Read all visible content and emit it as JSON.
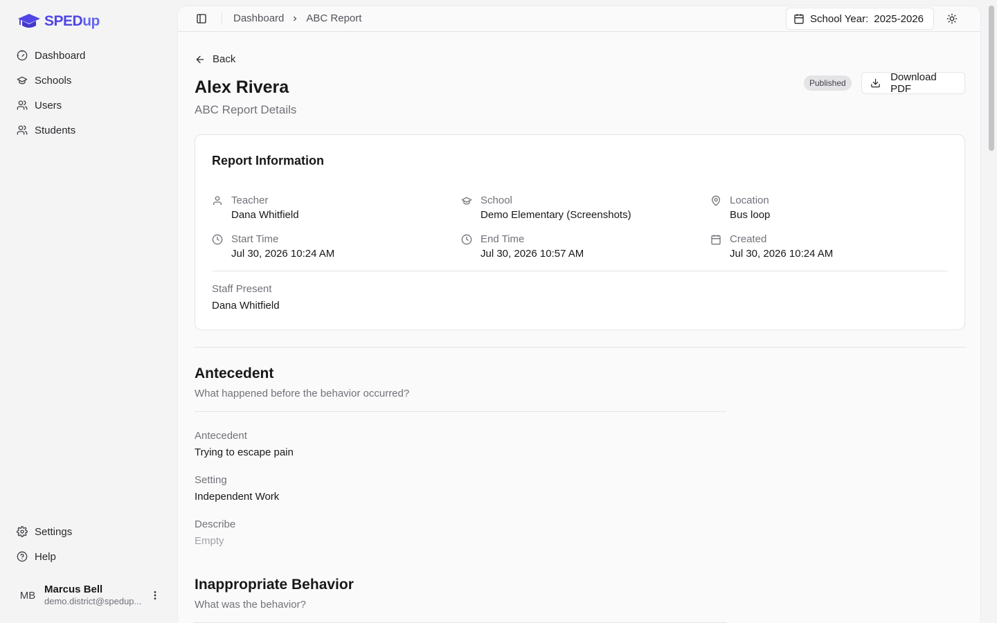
{
  "brand": {
    "name_main": "SPED",
    "name_accent": "up"
  },
  "sidebar": {
    "items": [
      {
        "label": "Dashboard",
        "icon": "gauge-icon"
      },
      {
        "label": "Schools",
        "icon": "graduation-cap-icon"
      },
      {
        "label": "Users",
        "icon": "users-icon"
      },
      {
        "label": "Students",
        "icon": "users-icon"
      }
    ],
    "bottom_items": [
      {
        "label": "Settings",
        "icon": "gear-icon"
      },
      {
        "label": "Help",
        "icon": "help-circle-icon"
      }
    ],
    "user": {
      "initials": "MB",
      "name": "Marcus Bell",
      "email": "demo.district@spedup..."
    }
  },
  "topbar": {
    "breadcrumb": [
      "Dashboard",
      "ABC Report"
    ],
    "school_year_label": "School Year:",
    "school_year_value": "2025-2026"
  },
  "page": {
    "back_label": "Back",
    "title": "Alex Rivera",
    "subtitle": "ABC Report Details",
    "status_badge": "Published",
    "download_label": "Download PDF"
  },
  "report_info": {
    "title": "Report Information",
    "fields": [
      {
        "label": "Teacher",
        "value": "Dana Whitfield",
        "icon": "user-icon"
      },
      {
        "label": "School",
        "value": "Demo Elementary (Screenshots)",
        "icon": "graduation-cap-icon"
      },
      {
        "label": "Location",
        "value": "Bus loop",
        "icon": "map-pin-icon"
      },
      {
        "label": "Start Time",
        "value": "Jul 30, 2026 10:24 AM",
        "icon": "clock-icon"
      },
      {
        "label": "End Time",
        "value": "Jul 30, 2026 10:57 AM",
        "icon": "clock-icon"
      },
      {
        "label": "Created",
        "value": "Jul 30, 2026 10:24 AM",
        "icon": "calendar-icon"
      }
    ],
    "staff_label": "Staff Present",
    "staff_value": "Dana Whitfield"
  },
  "antecedent": {
    "title": "Antecedent",
    "subtitle": "What happened before the behavior occurred?",
    "fields": [
      {
        "label": "Antecedent",
        "value": "Trying to escape pain"
      },
      {
        "label": "Setting",
        "value": "Independent Work"
      },
      {
        "label": "Describe",
        "value": "Empty"
      }
    ]
  },
  "behavior": {
    "title": "Inappropriate Behavior",
    "subtitle": "What was the behavior?"
  }
}
